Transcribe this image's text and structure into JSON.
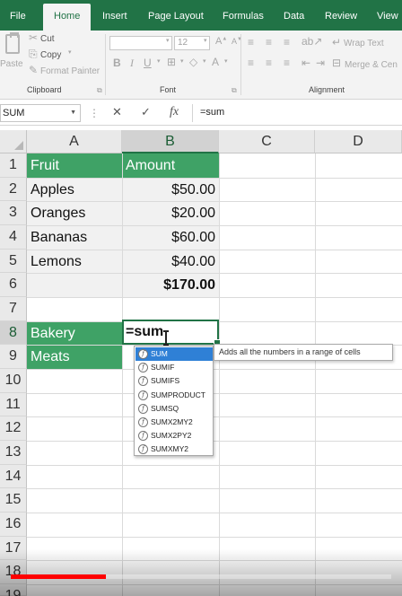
{
  "ribbon_tabs": [
    "File",
    "Home",
    "Insert",
    "Page Layout",
    "Formulas",
    "Data",
    "Review",
    "View"
  ],
  "clipboard": {
    "paste": "Paste",
    "cut": "Cut",
    "copy": "Copy",
    "format_painter": "Format Painter",
    "group_label": "Clipboard"
  },
  "font": {
    "size": "12",
    "group_label": "Font"
  },
  "alignment": {
    "wrap_text": "Wrap Text",
    "merge": "Merge & Cen",
    "group_label": "Alignment"
  },
  "formula_bar": {
    "name_box": "SUM",
    "cancel": "✕",
    "enter": "✓",
    "fx": "fx",
    "formula": "=sum"
  },
  "columns": [
    "A",
    "B",
    "C",
    "D"
  ],
  "rows": [
    "1",
    "2",
    "3",
    "4",
    "5",
    "6",
    "7",
    "8",
    "9",
    "10",
    "11",
    "12",
    "13",
    "14",
    "15",
    "16",
    "17",
    "18",
    "19"
  ],
  "sheet": {
    "a1": "Fruit",
    "b1": "Amount",
    "a2": "Apples",
    "b2": "$50.00",
    "a3": "Oranges",
    "b3": "$20.00",
    "a4": "Bananas",
    "b4": "$60.00",
    "a5": "Lemons",
    "b5": "$40.00",
    "b6": "$170.00",
    "a8": "Bakery",
    "b8": "=sum",
    "a9": "Meats"
  },
  "autocomplete": {
    "items": [
      "SUM",
      "SUMIF",
      "SUMIFS",
      "SUMPRODUCT",
      "SUMSQ",
      "SUMX2MY2",
      "SUMX2PY2",
      "SUMXMY2"
    ],
    "tooltip": "Adds all the numbers in a range of cells"
  },
  "colors": {
    "excel_green": "#217346",
    "header_fill": "#3fa266",
    "selection_blue": "#2f80d6",
    "progress_red": "#ff0000"
  },
  "video": {
    "progress": 0.25
  }
}
